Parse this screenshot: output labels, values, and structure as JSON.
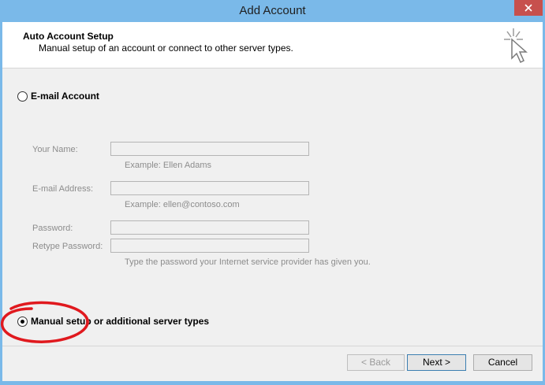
{
  "window": {
    "title": "Add Account",
    "close_icon": "close-icon"
  },
  "header": {
    "title": "Auto Account Setup",
    "subtitle": "Manual setup of an account or connect to other server types.",
    "icon": "wizard-cursor-icon"
  },
  "email_account": {
    "radio_label": "E-mail Account",
    "selected": false,
    "fields": {
      "name_label": "Your Name:",
      "name_value": "",
      "name_example": "Example: Ellen Adams",
      "email_label": "E-mail Address:",
      "email_value": "",
      "email_example": "Example: ellen@contoso.com",
      "password_label": "Password:",
      "password_value": "",
      "retype_label": "Retype Password:",
      "retype_value": "",
      "password_hint": "Type the password your Internet service provider has given you."
    }
  },
  "manual_setup": {
    "radio_label": "Manual setup or additional server types",
    "selected": true
  },
  "buttons": {
    "back": "< Back",
    "next": "Next >",
    "cancel": "Cancel"
  },
  "colors": {
    "titlebar": "#7ab9e9",
    "close": "#c7504d",
    "annotation": "#e0191e"
  }
}
